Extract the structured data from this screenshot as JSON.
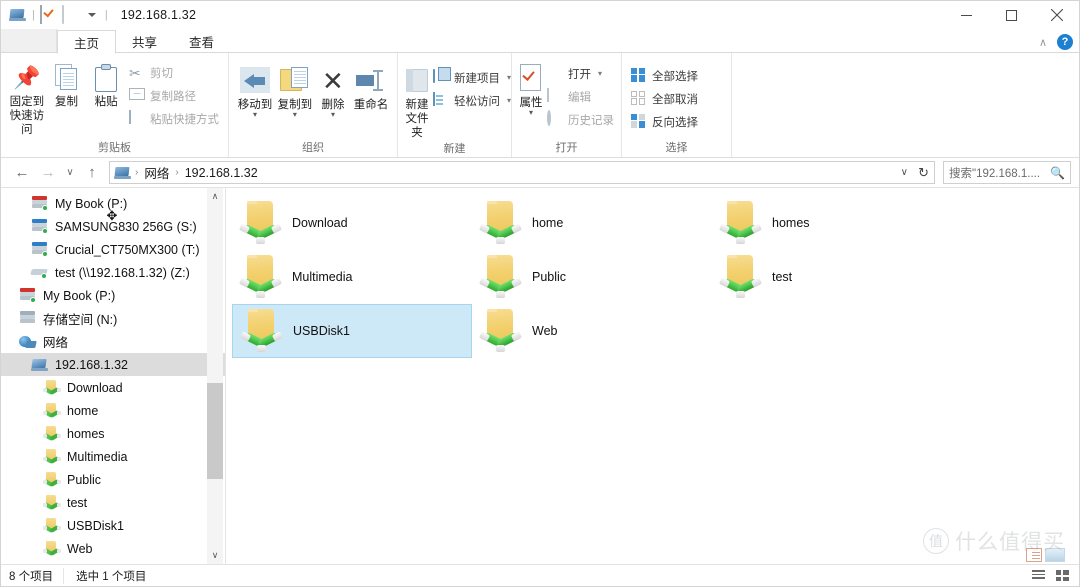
{
  "window": {
    "title": "192.168.1.32",
    "quick_access": [
      "pc-icon",
      "checkbox-icon",
      "folder-icon",
      "dropdown-caret"
    ],
    "minimize_label": "–",
    "maximize_label": "□",
    "close_label": "✕",
    "ribbon_collapse_label": "∧",
    "help_label": "?"
  },
  "tabs": [
    {
      "label": "主页",
      "active": true
    },
    {
      "label": "共享",
      "active": false
    },
    {
      "label": "查看",
      "active": false
    }
  ],
  "ribbon": {
    "groups": [
      {
        "label": "剪贴板",
        "big": [
          {
            "label": "固定到\n快速访问",
            "line1": "固定到",
            "line2": "快速访问",
            "icon": "pin-icon"
          },
          {
            "line1": "复制",
            "line2": "",
            "icon": "copy-icon"
          },
          {
            "line1": "粘贴",
            "line2": "",
            "icon": "paste-icon"
          }
        ],
        "small": [
          {
            "label": "剪切",
            "icon": "scissors-icon",
            "dim": true
          },
          {
            "label": "复制路径",
            "icon": "copy-path-icon",
            "dim": true
          },
          {
            "label": "粘贴快捷方式",
            "icon": "paste-shortcut-icon",
            "dim": true
          }
        ]
      },
      {
        "label": "组织",
        "big": [
          {
            "line1": "移动到",
            "line2": "",
            "icon": "move-to-icon",
            "caret": true
          },
          {
            "line1": "复制到",
            "line2": "",
            "icon": "copy-to-icon",
            "caret": true
          },
          {
            "line1": "删除",
            "line2": "",
            "icon": "delete-icon",
            "caret": true
          },
          {
            "line1": "重命名",
            "line2": "",
            "icon": "rename-icon"
          }
        ],
        "small": []
      },
      {
        "label": "新建",
        "big": [
          {
            "line1": "新建",
            "line2": "文件夹",
            "icon": "new-folder-icon"
          }
        ],
        "small": [
          {
            "label": "新建项目",
            "icon": "new-item-icon",
            "caret": true
          },
          {
            "label": "轻松访问",
            "icon": "easy-access-icon",
            "caret": true
          }
        ]
      },
      {
        "label": "打开",
        "big": [
          {
            "line1": "属性",
            "line2": "",
            "icon": "properties-icon",
            "caret": true
          }
        ],
        "small": [
          {
            "label": "打开",
            "icon": "open-icon",
            "caret": true
          },
          {
            "label": "编辑",
            "icon": "edit-icon",
            "dim": true
          },
          {
            "label": "历史记录",
            "icon": "history-icon",
            "dim": true
          }
        ]
      },
      {
        "label": "选择",
        "big": [],
        "small": [
          {
            "label": "全部选择",
            "icon": "select-all-icon"
          },
          {
            "label": "全部取消",
            "icon": "select-none-icon"
          },
          {
            "label": "反向选择",
            "icon": "invert-selection-icon"
          }
        ]
      }
    ]
  },
  "addressbar": {
    "back_label": "←",
    "forward_label": "→",
    "recent_label": "∨",
    "up_label": "↑",
    "crumb_icon": "pc-icon",
    "crumbs": [
      "网络",
      "192.168.1.32"
    ],
    "separator": "›",
    "dropdown_label": "∨",
    "refresh_label": "↻"
  },
  "search": {
    "placeholder": "搜索\"192.168.1....",
    "icon": "search-icon"
  },
  "navpane": {
    "items": [
      {
        "label": "My Book (P:)",
        "icon": "drive-red-icon",
        "indent": 2,
        "selected": false
      },
      {
        "label": "SAMSUNG830 256G (S:)",
        "icon": "drive-blue-icon",
        "indent": 2,
        "selected": false
      },
      {
        "label": "Crucial_CT750MX300 (T:)",
        "icon": "drive-blue-icon",
        "indent": 2,
        "selected": false
      },
      {
        "label": "test (\\\\192.168.1.32) (Z:)",
        "icon": "network-drive-icon",
        "indent": 2,
        "selected": false
      },
      {
        "label": "My Book (P:)",
        "icon": "drive-red-icon",
        "indent": 1,
        "selected": false
      },
      {
        "label": "存储空间 (N:)",
        "icon": "drive-gray-icon",
        "indent": 1,
        "selected": false
      },
      {
        "label": "网络",
        "icon": "network-icon",
        "indent": 1,
        "selected": false
      },
      {
        "label": "192.168.1.32",
        "icon": "pc-icon",
        "indent": 2,
        "selected": true
      },
      {
        "label": "Download",
        "icon": "shared-folder-icon",
        "indent": 3,
        "selected": false
      },
      {
        "label": "home",
        "icon": "shared-folder-icon",
        "indent": 3,
        "selected": false
      },
      {
        "label": "homes",
        "icon": "shared-folder-icon",
        "indent": 3,
        "selected": false
      },
      {
        "label": "Multimedia",
        "icon": "shared-folder-icon",
        "indent": 3,
        "selected": false
      },
      {
        "label": "Public",
        "icon": "shared-folder-icon",
        "indent": 3,
        "selected": false
      },
      {
        "label": "test",
        "icon": "shared-folder-icon",
        "indent": 3,
        "selected": false
      },
      {
        "label": "USBDisk1",
        "icon": "shared-folder-icon",
        "indent": 3,
        "selected": false
      },
      {
        "label": "Web",
        "icon": "shared-folder-icon",
        "indent": 3,
        "selected": false
      }
    ],
    "scroll_up_label": "∧",
    "scroll_down_label": "∨"
  },
  "content": {
    "rows": [
      [
        {
          "label": "Download",
          "icon": "shared-folder-icon",
          "selected": false
        },
        {
          "label": "home",
          "icon": "shared-folder-icon",
          "selected": false
        },
        {
          "label": "homes",
          "icon": "shared-folder-icon",
          "selected": false
        }
      ],
      [
        {
          "label": "Multimedia",
          "icon": "shared-folder-icon",
          "selected": false
        },
        {
          "label": "Public",
          "icon": "shared-folder-icon",
          "selected": false
        },
        {
          "label": "test",
          "icon": "shared-folder-icon",
          "selected": false
        }
      ],
      [
        {
          "label": "USBDisk1",
          "icon": "shared-folder-icon",
          "selected": true
        },
        {
          "label": "Web",
          "icon": "shared-folder-icon",
          "selected": false
        },
        {
          "label": "",
          "icon": "",
          "selected": false
        }
      ]
    ]
  },
  "watermark": {
    "mark_char": "值",
    "text": "什么值得买"
  },
  "status": {
    "item_count": "8 个项目",
    "selected_count": "选中 1 个项目",
    "view_details_icon": "details-view-icon",
    "view_tiles_icon": "tiles-view-icon"
  },
  "colors": {
    "selection_fill": "#cde8f7",
    "selection_border": "#a8d4ee",
    "nav_selection": "#dcdcdc",
    "accent_blue": "#1d7fd0",
    "folder_yellow": "#f3d272",
    "pipe_green": "#2faa2f"
  }
}
